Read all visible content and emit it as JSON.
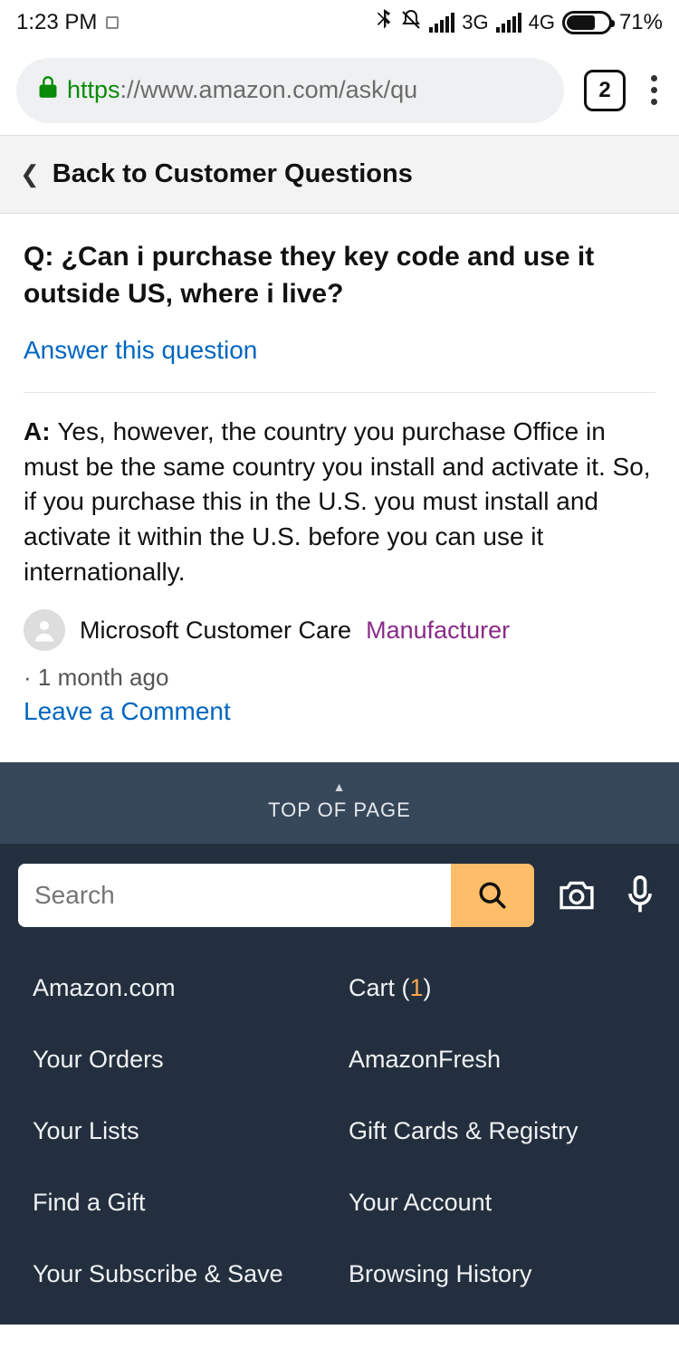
{
  "status": {
    "time": "1:23 PM",
    "net1": "3G",
    "net2": "4G",
    "battery": "71%"
  },
  "browser": {
    "https": "https",
    "url_rest": "://www.amazon.com/ask/qu",
    "tabs": "2"
  },
  "back": {
    "label": "Back to Customer Questions"
  },
  "qa": {
    "q_prefix": "Q: ",
    "question": "¿Can i purchase they key code and use it outside US, where i live?",
    "answer_link": "Answer this question",
    "a_prefix": "A: ",
    "answer": "Yes, however, the country you purchase Office in must be the same country you install and activate it. So, if you purchase this in the U.S. you must install and activate it within the U.S. before you can use it internationally.",
    "author": "Microsoft Customer Care",
    "badge": "Manufacturer",
    "time": "· 1 month ago",
    "comment": "Leave a Comment"
  },
  "footer": {
    "top": "TOP OF PAGE",
    "search_placeholder": "Search",
    "links_left": [
      "Amazon.com",
      "Your Orders",
      "Your Lists",
      "Find a Gift",
      "Your Subscribe & Save"
    ],
    "links_right_cart_label": "Cart (",
    "links_right_cart_count": "1",
    "links_right_cart_close": ")",
    "links_right": [
      "AmazonFresh",
      "Gift Cards & Registry",
      "Your Account",
      "Browsing History"
    ]
  }
}
